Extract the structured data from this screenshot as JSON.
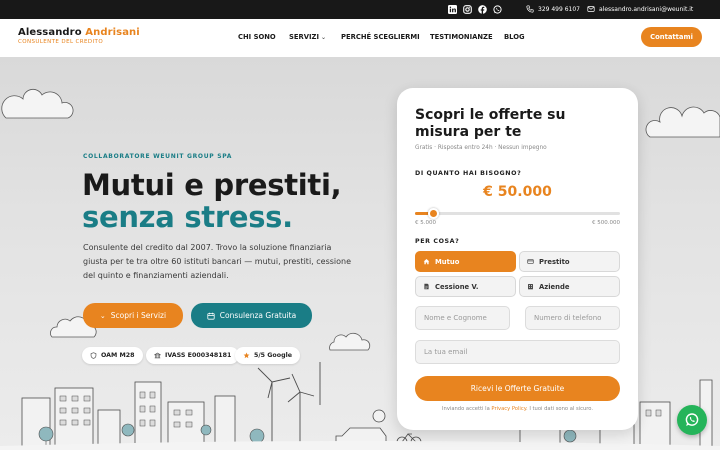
{
  "topbar": {
    "social": [
      "linkedin-icon",
      "instagram-icon",
      "facebook-icon",
      "whatsapp-icon"
    ],
    "phone": "329 499 6107",
    "email": "alessandro.andrisani@weunit.it"
  },
  "header": {
    "logo_first": "Alessandro",
    "logo_last": "Andrisani",
    "logo_sub": "CONSULENTE DEL CREDITO",
    "nav": [
      "CHI SONO",
      "SERVIZI",
      "PERCHÉ SCEGLIERMI",
      "TESTIMONIANZE",
      "BLOG"
    ],
    "cta": "Contattami"
  },
  "hero": {
    "eyebrow": "COLLABORATORE WEUNIT GROUP SPA",
    "title_line1": "Mutui e prestiti,",
    "title_line2": "senza stress.",
    "lead": "Consulente del credito dal 2007. Trovo la soluzione finanziaria giusta per te tra oltre 60 istituti bancari — mutui, prestiti, cessione del quinto e finanziamenti aziendali.",
    "btn_services": "Scopri i Servizi",
    "btn_consult": "Consulenza Gratuita",
    "badges": [
      "OAM M28",
      "IVASS E000348181",
      "5/5 Google"
    ]
  },
  "form": {
    "title": "Scopri le offerte su misura per te",
    "subtitle": "Gratis · Risposta entro 24h · Nessun impegno",
    "amount_label": "DI QUANTO HAI BISOGNO?",
    "amount": "€ 50.000",
    "range_min": "€ 5.000",
    "range_max": "€ 500.000",
    "slider_fraction": 0.09,
    "purpose_label": "PER COSA?",
    "options": [
      "Mutuo",
      "Prestito",
      "Cessione V.",
      "Aziende"
    ],
    "selected": "Mutuo",
    "name_placeholder": "Nome e Cognome",
    "phone_placeholder": "Numero di telefono",
    "email_placeholder": "La tua email",
    "submit": "Ricevi le Offerte Gratuite",
    "privacy_pre": "Inviando accetti la",
    "privacy_link": "Privacy Policy",
    "privacy_post": ". I tuoi dati sono al sicuro."
  },
  "colors": {
    "accent": "#e8841f",
    "teal": "#1a7d86",
    "dark": "#181818",
    "whatsapp": "#25b45a"
  }
}
